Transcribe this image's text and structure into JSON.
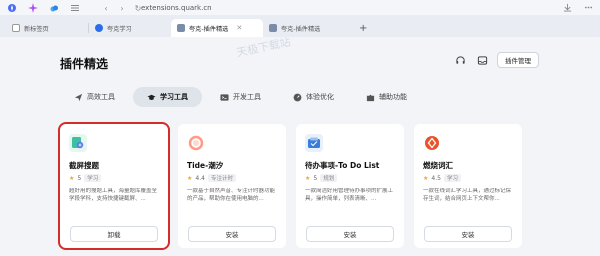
{
  "browser": {
    "url": "extensions.quark.cn",
    "tabs": [
      {
        "label": "新标签页",
        "active": false
      },
      {
        "label": "夸克学习",
        "active": false
      },
      {
        "label": "夸克-插件精选",
        "active": true
      },
      {
        "label": "夸克-插件精选",
        "active": false
      }
    ]
  },
  "page": {
    "title": "插件精选",
    "watermark": "天极下载站",
    "manage_label": "插件管理"
  },
  "categories": [
    {
      "label": "高效工具",
      "icon": "paper-plane-icon",
      "active": false
    },
    {
      "label": "学习工具",
      "icon": "graduation-cap-icon",
      "active": true
    },
    {
      "label": "开发工具",
      "icon": "terminal-icon",
      "active": false
    },
    {
      "label": "体验优化",
      "icon": "gauge-icon",
      "active": false
    },
    {
      "label": "辅助功能",
      "icon": "puzzle-icon",
      "active": false
    }
  ],
  "cards": [
    {
      "name": "截屏搜题",
      "rating": "5",
      "tag": "学习",
      "desc": "超好用的搜题工具，海量题库覆盖全学段学科，支持快捷键截屏、...",
      "button": "卸载",
      "icon_color": "#3cc0a0"
    },
    {
      "name": "Tide-潮汐",
      "rating": "4.4",
      "tag": "专注计时",
      "desc": "一款基于自然声音、专注计时器功能的产品，帮助你在使用电脑的...",
      "button": "安装",
      "icon_color": "#ff8a7a"
    },
    {
      "name": "待办事项-To Do List",
      "rating": "5",
      "tag": "规划",
      "desc": "一款简洁好用管理待办事项的扩展工具，操作简单，列表清晰、...",
      "button": "安装",
      "icon_color": "#3b7dd8"
    },
    {
      "name": "燃烧词汇",
      "rating": "4.5",
      "tag": "学习",
      "desc": "一款在线词汇学习工具，通过标记保存生词，结合网页上下文帮你...",
      "button": "安装",
      "icon_color": "#e8532b"
    }
  ]
}
